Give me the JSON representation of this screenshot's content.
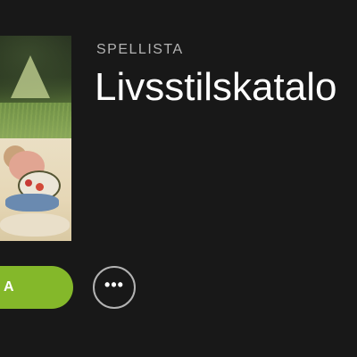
{
  "playlist": {
    "type_label": "SPELLISTA",
    "title": "Livsstilskatalo"
  },
  "cover": {
    "icon": "playlist-cover-collage"
  },
  "actions": {
    "play_label": "A",
    "more_icon": "more-dots-icon",
    "more_glyph": "•••"
  },
  "colors": {
    "background": "#181818",
    "accent": "#84b82a",
    "muted_text": "#b3b3b3"
  }
}
